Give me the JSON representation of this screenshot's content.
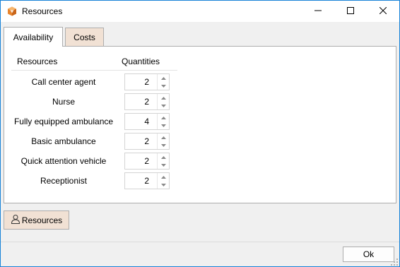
{
  "window": {
    "title": "Resources",
    "icon": "app-cube-icon",
    "accent": "#e8842c",
    "border": "#1883d7"
  },
  "titlebar": {
    "minimize": "minimize-icon",
    "maximize": "maximize-icon",
    "close": "close-icon"
  },
  "tabs": [
    {
      "label": "Availability",
      "active": true
    },
    {
      "label": "Costs",
      "active": false,
      "color": "#f1e1d4"
    }
  ],
  "table": {
    "headers": {
      "resources": "Resources",
      "quantities": "Quantities"
    },
    "rows": [
      {
        "label": "Call center agent",
        "qty": "2"
      },
      {
        "label": "Nurse",
        "qty": "2"
      },
      {
        "label": "Fully equipped ambulance",
        "qty": "4"
      },
      {
        "label": "Basic ambulance",
        "qty": "2"
      },
      {
        "label": "Quick attention vehicle",
        "qty": "2"
      },
      {
        "label": "Receptionist",
        "qty": "2"
      }
    ]
  },
  "resources_button": {
    "label": "Resources",
    "icon": "person-icon"
  },
  "ok_button": {
    "label": "Ok"
  }
}
